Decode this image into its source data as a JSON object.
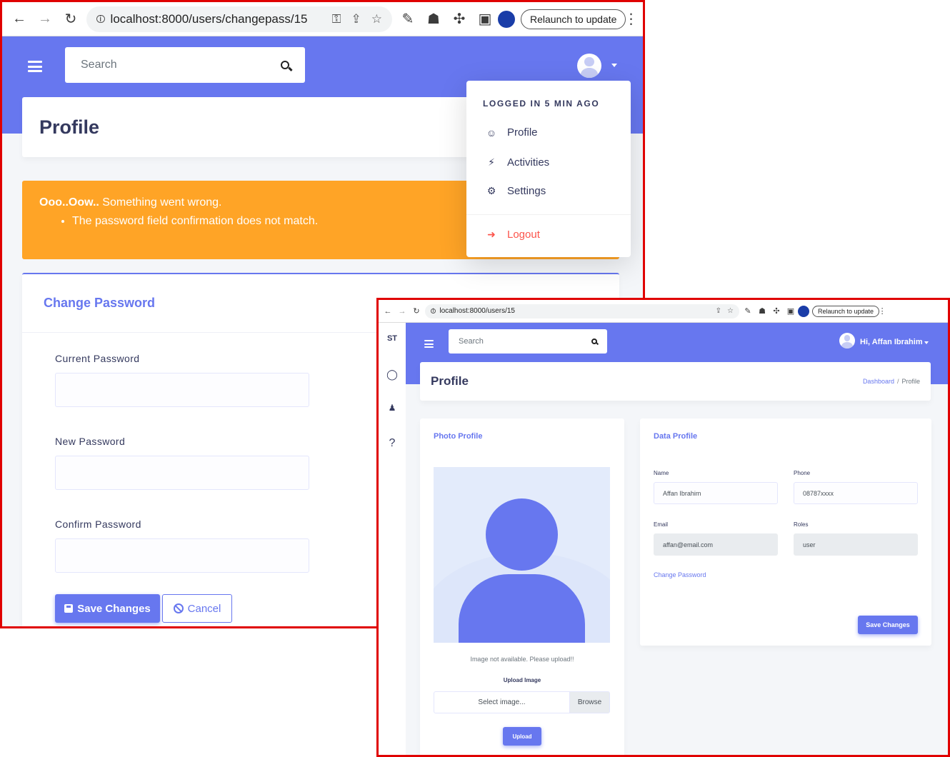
{
  "screenshotA": {
    "browser": {
      "url": "localhost:8000/users/changepass/15",
      "relaunch_label": "Relaunch to update"
    },
    "search": {
      "placeholder": "Search"
    },
    "page_title": "Profile",
    "alert": {
      "title_bold": "Ooo..Oow..",
      "title_rest": " Something went wrong.",
      "errors": [
        "The password field confirmation does not match."
      ]
    },
    "card": {
      "title": "Change Password",
      "fields": [
        {
          "label": "Current Password",
          "value": ""
        },
        {
          "label": "New Password",
          "value": ""
        },
        {
          "label": "Confirm Password",
          "value": ""
        }
      ],
      "save_label": "Save Changes",
      "cancel_label": "Cancel"
    },
    "dropdown": {
      "title": "LOGGED IN 5 MIN AGO",
      "items": [
        {
          "label": "Profile",
          "icon": "user-icon"
        },
        {
          "label": "Activities",
          "icon": "bolt-icon"
        },
        {
          "label": "Settings",
          "icon": "gear-icon"
        }
      ],
      "logout_label": "Logout",
      "logout_color": "#fc544b"
    }
  },
  "screenshotB": {
    "browser": {
      "url": "localhost:8000/users/15",
      "relaunch_label": "Relaunch to update"
    },
    "sidebar": {
      "brand": "ST",
      "icons": [
        "fire-icon",
        "users-icon",
        "question-icon"
      ]
    },
    "search": {
      "placeholder": "Search"
    },
    "user_greeting": "Hi, Affan Ibrahim",
    "page_title": "Profile",
    "breadcrumb": {
      "link": "Dashboard",
      "separator": "/",
      "current": "Profile"
    },
    "photo_card": {
      "title": "Photo Profile",
      "no_image_text": "Image not available. Please upload!!",
      "upload_label": "Upload Image",
      "file_placeholder": "Select image...",
      "browse_label": "Browse",
      "upload_button": "Upload"
    },
    "data_card": {
      "title": "Data Profile",
      "name_label": "Name",
      "name_value": "Affan Ibrahim",
      "phone_label": "Phone",
      "phone_value": "08787xxxx",
      "email_label": "Email",
      "email_value": "affan@email.com",
      "roles_label": "Roles",
      "roles_value": "user",
      "change_password_link": "Change Password",
      "save_label": "Save Changes"
    }
  },
  "colors": {
    "primary": "#6777ef",
    "warning": "#ffa426",
    "frame": "#e00000"
  }
}
